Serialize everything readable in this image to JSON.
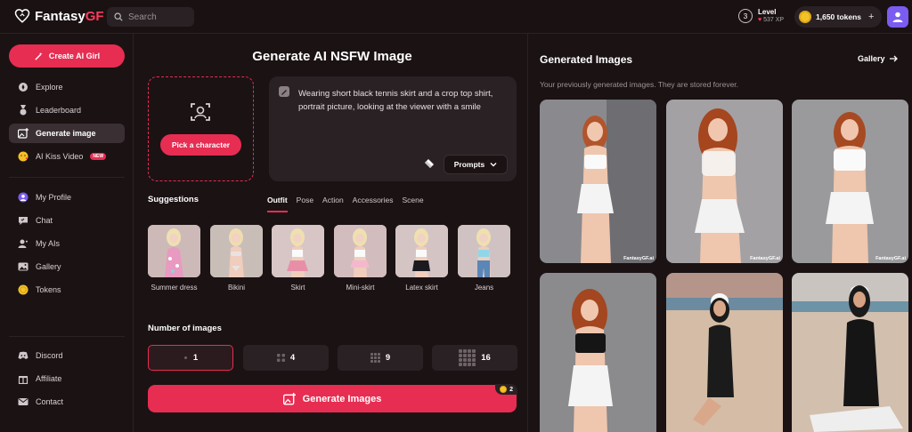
{
  "header": {
    "logo_main": "Fantasy",
    "logo_accent": "GF",
    "search_placeholder": "Search",
    "level_number": "3",
    "level_label": "Level",
    "level_xp": "537 XP",
    "tokens_label": "1,650 tokens",
    "tokens_plus": "+"
  },
  "sidebar": {
    "create_label": "Create AI Girl",
    "items": [
      {
        "label": "Explore",
        "icon": "compass-icon"
      },
      {
        "label": "Leaderboard",
        "icon": "medal-icon"
      },
      {
        "label": "Generate image",
        "icon": "image-plus-icon",
        "active": true
      },
      {
        "label": "AI Kiss Video",
        "icon": "kiss-emoji-icon",
        "badge": "NEW"
      },
      {
        "label": "My Profile",
        "icon": "profile-icon"
      },
      {
        "label": "Chat",
        "icon": "chat-icon"
      },
      {
        "label": "My AIs",
        "icon": "heart-user-icon"
      },
      {
        "label": "Gallery",
        "icon": "gallery-icon"
      },
      {
        "label": "Tokens",
        "icon": "coin-icon"
      },
      {
        "label": "Discord",
        "icon": "discord-icon"
      },
      {
        "label": "Affiliate",
        "icon": "gift-icon"
      },
      {
        "label": "Contact",
        "icon": "mail-icon"
      }
    ]
  },
  "generator": {
    "title": "Generate AI NSFW Image",
    "pick_label": "Pick a character",
    "prompt_text": "Wearing short black tennis skirt and a crop top shirt, portrait picture, looking at the viewer with a smile",
    "prompts_label": "Prompts",
    "suggestions_title": "Suggestions",
    "tabs": [
      "Outfit",
      "Pose",
      "Action",
      "Accessories",
      "Scene"
    ],
    "active_tab": "Outfit",
    "suggestions": [
      {
        "label": "Summer dress"
      },
      {
        "label": "Bikini"
      },
      {
        "label": "Skirt"
      },
      {
        "label": "Mini-skirt"
      },
      {
        "label": "Latex skirt"
      },
      {
        "label": "Jeans"
      }
    ],
    "number_title": "Number of images",
    "number_options": [
      "1",
      "4",
      "9",
      "16"
    ],
    "number_selected": "1",
    "generate_label": "Generate Images",
    "generate_cost": "2"
  },
  "generated": {
    "title": "Generated Images",
    "gallery_label": "Gallery",
    "subtitle": "Your previously generated images. They are stored forever.",
    "watermark": "FantasyGF.ai"
  },
  "colors": {
    "accent": "#e72d52",
    "background": "#1b1214",
    "panel": "#2a2124"
  }
}
